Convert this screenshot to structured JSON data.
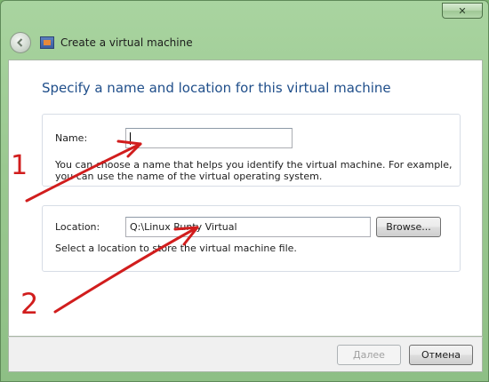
{
  "window": {
    "title": "Create a virtual machine",
    "close_glyph": "✕",
    "back_glyph": "◀"
  },
  "main": {
    "heading": "Specify a name and location for this virtual machine",
    "name_group": {
      "label": "Name:",
      "value": "",
      "description_line1": "You can choose a name that helps you identify the virtual machine. For example,",
      "description_line2": "you can use the name of the virtual operating system."
    },
    "location_group": {
      "label": "Location:",
      "value": "Q:\\Linux Runty Virtual",
      "browse_label": "Browse...",
      "description": "Select a location to store the virtual machine file."
    }
  },
  "footer": {
    "next_label": "Далее",
    "cancel_label": "Отмена"
  },
  "annotations": {
    "marker_1": "1",
    "marker_2": "2",
    "color": "#d11d1d"
  },
  "colors": {
    "heading": "#1f4e8a",
    "frame": "#9ac890"
  }
}
